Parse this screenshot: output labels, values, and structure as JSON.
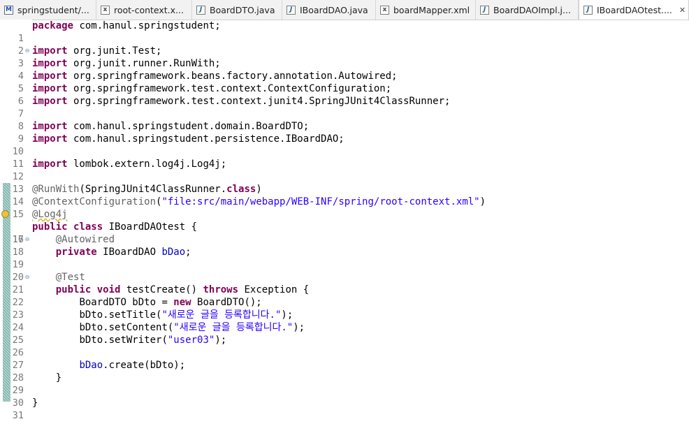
{
  "tabs": [
    {
      "label": "springstudent/...",
      "icon": "maven-pom-icon"
    },
    {
      "label": "root-context.x...",
      "icon": "xml-file-icon"
    },
    {
      "label": "BoardDTO.java",
      "icon": "java-file-icon"
    },
    {
      "label": "IBoardDAO.java",
      "icon": "java-file-icon"
    },
    {
      "label": "boardMapper.xml",
      "icon": "xml-file-icon"
    },
    {
      "label": "BoardDAOImpl.j...",
      "icon": "java-file-icon"
    },
    {
      "label": "IBoardDAOtest....",
      "icon": "java-file-icon"
    }
  ],
  "active_tab": 6,
  "close_glyph": "✕",
  "line_numbers": [
    "1",
    "2",
    "3",
    "4",
    "5",
    "6",
    "7",
    "8",
    "9",
    "10",
    "11",
    "12",
    "13",
    "14",
    "15",
    "16",
    "17",
    "18",
    "19",
    "20",
    "21",
    "22",
    "23",
    "24",
    "25",
    "26",
    "27",
    "28",
    "29",
    "30",
    "31"
  ],
  "code": {
    "l1_kw": "package",
    "l1_rest": " com.hanul.springstudent;",
    "import_kw": "import",
    "l3_rest": " org.junit.Test;",
    "l4_rest": " org.junit.runner.RunWith;",
    "l5_rest": " org.springframework.beans.factory.annotation.Autowired;",
    "l6_rest": " org.springframework.test.context.ContextConfiguration;",
    "l7_rest": " org.springframework.test.context.junit4.SpringJUnit4ClassRunner;",
    "l9_rest": " com.hanul.springstudent.domain.BoardDTO;",
    "l10_rest": " com.hanul.springstudent.persistence.IBoardDAO;",
    "l12_rest": " lombok.extern.log4j.Log4j;",
    "l14_ann": "@RunWith",
    "l14_a": "(SpringJUnit4ClassRunner.",
    "l14_kw": "class",
    "l14_b": ")",
    "l15_ann": "@ContextConfiguration",
    "l15_a": "(",
    "l15_str": "\"file:src/main/webapp/WEB-INF/spring/root-context.xml\"",
    "l15_b": ")",
    "l16_ann": "@Log4j",
    "l17_kw1": "public",
    "l17_kw2": "class",
    "l17_rest": " IBoardDAOtest {",
    "l18_ann": "@Autowired",
    "l19_kw": "private",
    "l19_a": " IBoardDAO ",
    "l19_fld": "bDao",
    "l19_b": ";",
    "l21_ann": "@Test",
    "l22_kw1": "public",
    "l22_kw2": "void",
    "l22_a": " testCreate() ",
    "l22_kw3": "throws",
    "l22_b": " Exception {",
    "l23_a": "BoardDTO bDto = ",
    "l23_kw": "new",
    "l23_b": " BoardDTO();",
    "l24_a": "bDto.setTitle(",
    "l24_str": "\"새로운 글을 등록합니다.\"",
    "l24_b": ");",
    "l25_a": "bDto.setContent(",
    "l25_str": "\"새로운 글을 등록합니다.\"",
    "l25_b": ");",
    "l26_a": "bDto.setWriter(",
    "l26_str": "\"user03\"",
    "l26_b": ");",
    "l28_fld": "bDao",
    "l28_b": ".create(bDto);",
    "l29_a": "}",
    "l31_a": "}"
  }
}
